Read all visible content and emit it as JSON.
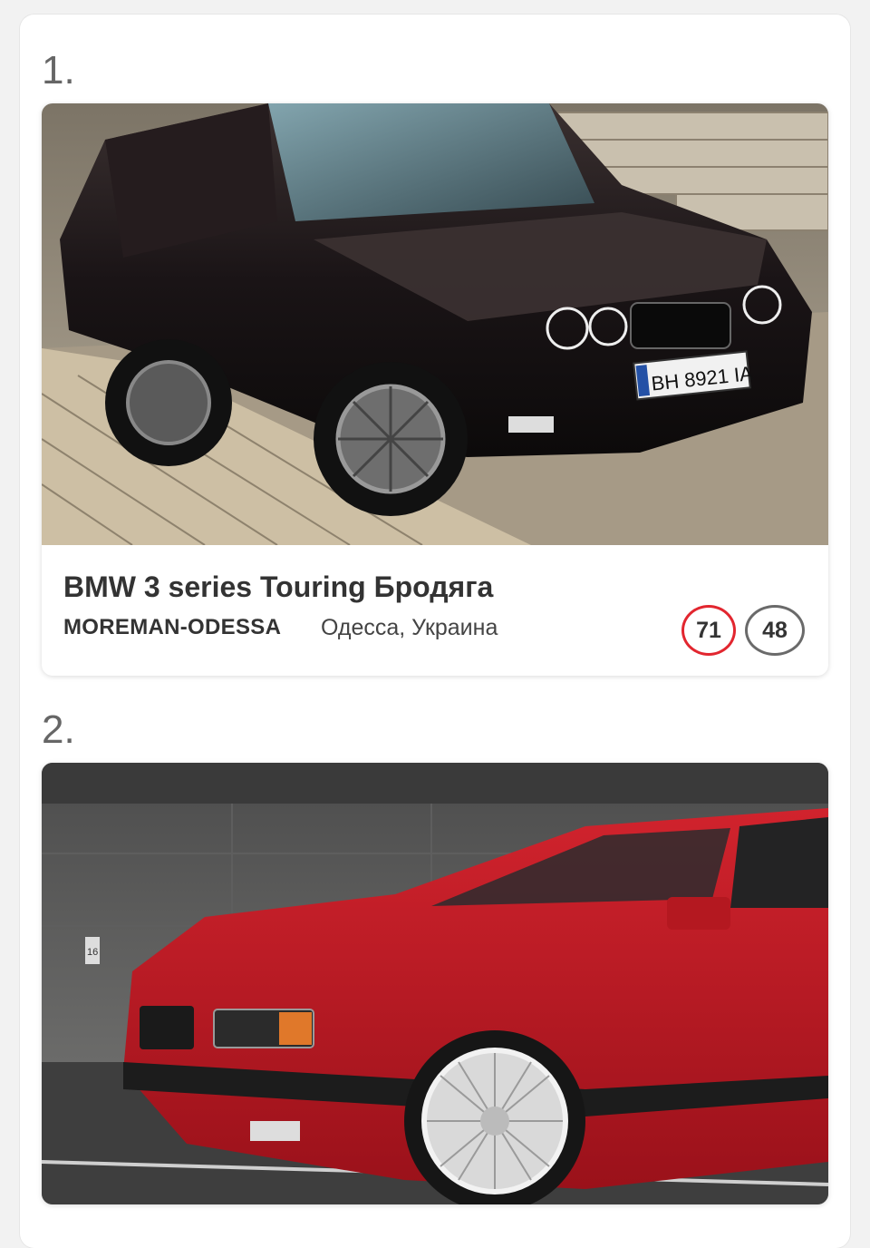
{
  "entries": [
    {
      "rank": "1.",
      "title": "BMW 3 series Touring Бродяга",
      "author": "MOREMAN-ODESSA",
      "location": "Одесса, Украина",
      "plate": "BH 8921 IA",
      "badges": {
        "red": "71",
        "grey": "48"
      }
    },
    {
      "rank": "2.",
      "plate_marker": "16"
    }
  ],
  "colors": {
    "badge_red": "#e2262f",
    "badge_grey": "#6a6a6a"
  }
}
